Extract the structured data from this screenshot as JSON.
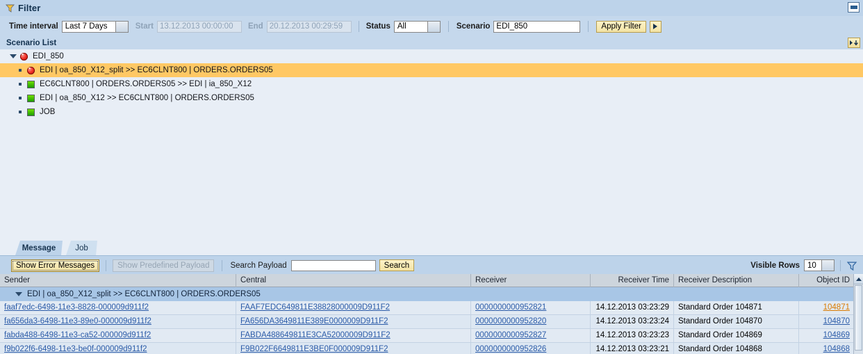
{
  "filter_panel": {
    "title": "Filter",
    "icon": "funnel-icon",
    "minimize_label": "",
    "time_interval_label": "Time interval",
    "time_interval_value": "Last 7 Days",
    "start_label": "Start",
    "start_value": "13.12.2013 00:00:00",
    "end_label": "End",
    "end_value": "20.12.2013 00:29:59",
    "status_label": "Status",
    "status_value": "All",
    "scenario_label": "Scenario",
    "scenario_value": "EDI_850",
    "scenario_placeholder": "",
    "apply_filter_label": "Apply Filter",
    "more_button_label": ""
  },
  "scenario_list": {
    "header": "Scenario List",
    "personalize_label": "",
    "items": [
      {
        "label": "EDI_850",
        "status": "red",
        "level": 0,
        "expanded": true,
        "selected": false
      },
      {
        "label": "EDI | oa_850_X12_split >> EC6CLNT800 | ORDERS.ORDERS05",
        "status": "red",
        "level": 1,
        "expanded": false,
        "selected": true
      },
      {
        "label": "EC6CLNT800 | ORDERS.ORDERS05 >> EDI | ia_850_X12",
        "status": "green",
        "level": 1,
        "expanded": false,
        "selected": false
      },
      {
        "label": "EDI | oa_850_X12 >> EC6CLNT800 | ORDERS.ORDERS05",
        "status": "green",
        "level": 1,
        "expanded": false,
        "selected": false
      },
      {
        "label": "JOB",
        "status": "green",
        "level": 1,
        "expanded": false,
        "selected": false
      }
    ]
  },
  "tabs": [
    {
      "label": "Message",
      "active": true
    },
    {
      "label": "Job",
      "active": false
    }
  ],
  "toolbar": {
    "show_error_messages_label": "Show Error Messages",
    "show_predefined_payload_label": "Show Predefined Payload",
    "search_payload_label": "Search Payload",
    "search_payload_value": "",
    "search_payload_placeholder": "",
    "search_button_label": "Search",
    "visible_rows_label": "Visible Rows",
    "visible_rows_value": "10",
    "filter_icon": "funnel-icon"
  },
  "table": {
    "columns": [
      {
        "key": "sender",
        "label": "Sender",
        "align": "left"
      },
      {
        "key": "central",
        "label": "Central",
        "align": "left"
      },
      {
        "key": "receiver",
        "label": "Receiver",
        "align": "left"
      },
      {
        "key": "receiver_time",
        "label": "Receiver Time",
        "align": "right"
      },
      {
        "key": "receiver_description",
        "label": "Receiver Description",
        "align": "left"
      },
      {
        "key": "object_id",
        "label": "Object ID",
        "align": "right"
      }
    ],
    "group_row": {
      "label": "EDI | oa_850_X12_split >> EC6CLNT800 | ORDERS.ORDERS05",
      "expanded": true
    },
    "rows": [
      {
        "sender": "faaf7edc-6498-11e3-8828-000009d911f2",
        "central": "FAAF7EDC649811E38828000009D911F2",
        "receiver": "0000000000952821",
        "receiver_time": "14.12.2013 03:23:29",
        "receiver_description": "Standard Order 104871",
        "object_id": "104871",
        "object_id_highlight": true
      },
      {
        "sender": "fa656da3-6498-11e3-89e0-000009d911f2",
        "central": "FA656DA3649811E389E0000009D911F2",
        "receiver": "0000000000952820",
        "receiver_time": "14.12.2013 03:23:24",
        "receiver_description": "Standard Order 104870",
        "object_id": "104870",
        "object_id_highlight": false
      },
      {
        "sender": "fabda488-6498-11e3-ca52-000009d911f2",
        "central": "FABDA488649811E3CA52000009D911F2",
        "receiver": "0000000000952827",
        "receiver_time": "14.12.2013 03:23:23",
        "receiver_description": "Standard Order 104869",
        "object_id": "104869",
        "object_id_highlight": false
      },
      {
        "sender": "f9b022f6-6498-11e3-be0f-000009d911f2",
        "central": "F9B022F6649811E3BE0F000009D911F2",
        "receiver": "0000000000952826",
        "receiver_time": "14.12.2013 03:23:21",
        "receiver_description": "Standard Order 104868",
        "object_id": "104868",
        "object_id_highlight": false
      }
    ]
  },
  "colors": {
    "accent_selected_row": "#ffc864",
    "panel_header": "#bdd3ea",
    "link": "#2b5ba8",
    "link_highlight": "#d97a00",
    "status_error": "#f03028",
    "status_ok": "#3fbf00"
  }
}
